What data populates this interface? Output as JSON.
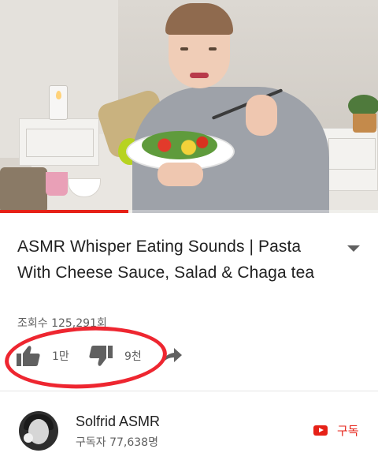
{
  "video": {
    "progress_fraction": 0.34,
    "accent_color": "#e62117"
  },
  "info": {
    "title": "ASMR Whisper Eating Sounds | Pasta With Cheese Sauce, Salad & Chaga tea",
    "views": "조회수 125,291회",
    "expand_icon": "chevron-down-icon"
  },
  "actions": {
    "like_icon": "thumbs-up-icon",
    "like_count": "1만",
    "dislike_icon": "thumbs-down-icon",
    "dislike_count": "9천",
    "share_icon": "share-icon"
  },
  "channel": {
    "name": "Solfrid ASMR",
    "subscribers": "구독자 77,638명",
    "subscribe_label": "구독",
    "subscribe_icon": "youtube-icon"
  },
  "annotation": {
    "highlight_color": "#ee2630"
  }
}
